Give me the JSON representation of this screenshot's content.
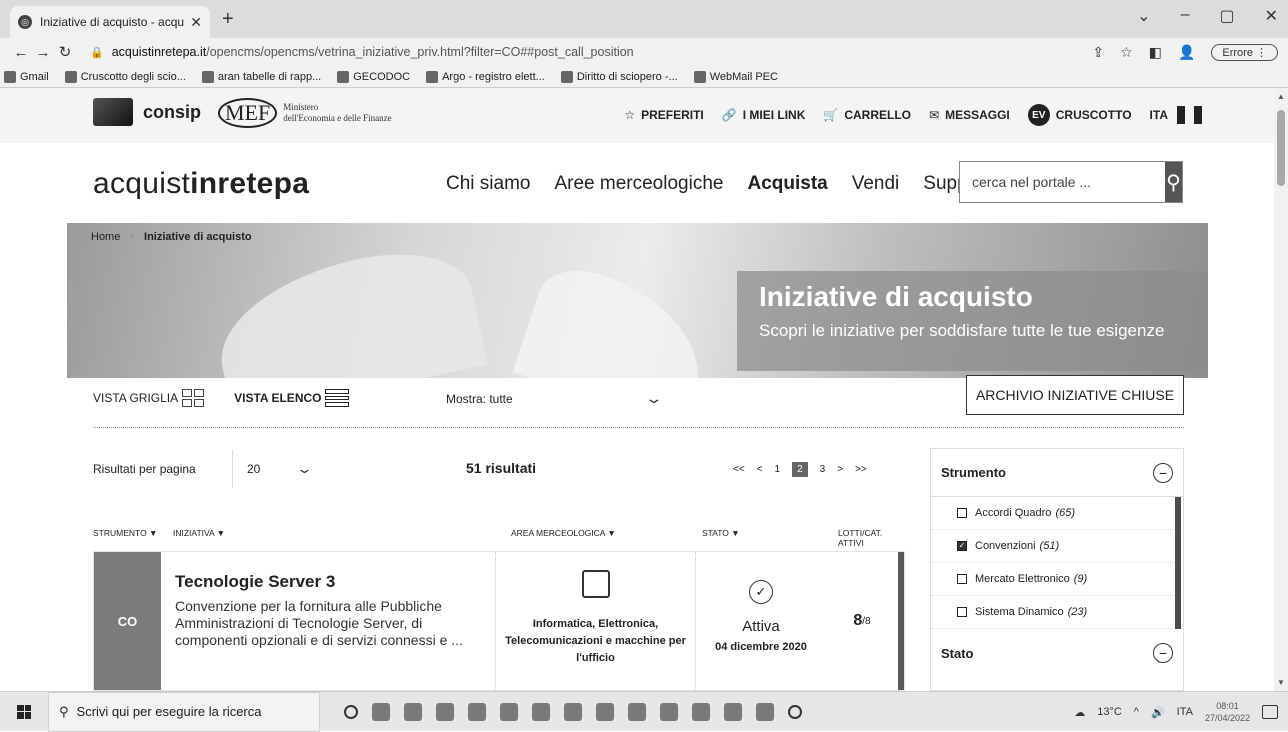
{
  "browser": {
    "tab_title": "Iniziative di acquisto - acquistinr",
    "url_host": "acquistinretepa.it",
    "url_path": "/opencms/opencms/vetrina_iniziative_priv.html?filter=CO##post_call_position",
    "error_label": "Errore",
    "bookmarks": [
      "Gmail",
      "Cruscotto degli scio...",
      "aran tabelle di rapp...",
      "GECODOC",
      "Argo - registro elett...",
      "Diritto di sciopero -...",
      "WebMail PEC"
    ]
  },
  "util": {
    "consip": "consip",
    "mef": "MEF",
    "mef_sub1": "Ministero",
    "mef_sub2": "dell'Economia e delle Finanze",
    "preferiti": "PREFERITI",
    "link": "I MIEI LINK",
    "carrello": "CARRELLO",
    "messaggi": "MESSAGGI",
    "avatar": "EV",
    "cruscotto": "CRUSCOTTO",
    "lang": "ITA"
  },
  "header": {
    "brand_light": "acquist",
    "brand_bold": "inretepa",
    "nav": [
      "Chi siamo",
      "Aree merceologiche",
      "Acquista",
      "Vendi",
      "Supporto"
    ],
    "search_placeholder": "cerca nel portale ..."
  },
  "hero": {
    "crumb_home": "Home",
    "crumb_current": "Iniziative di acquisto",
    "title": "Iniziative di acquisto",
    "subtitle": "Scopri le iniziative per soddisfare tutte le tue esigenze"
  },
  "controls": {
    "vista_griglia": "VISTA GRIGLIA",
    "vista_elenco": "VISTA ELENCO",
    "mostra": "Mostra: tutte",
    "archivio": "ARCHIVIO INIZIATIVE CHIUSE"
  },
  "results": {
    "per_page_label": "Risultati per pagina",
    "per_page_value": "20",
    "count": "51 risultati",
    "pager": [
      "<<",
      "<",
      "1",
      "2",
      "3",
      ">",
      ">>"
    ],
    "current_page": "2"
  },
  "table": {
    "headers": [
      "STRUMENTO ▼",
      "INIZIATIVA ▼",
      "AREA MERCEOLOGICA ▼",
      "STATO ▼",
      "LOTTI/CAT. ATTIVI"
    ]
  },
  "card": {
    "code": "CO",
    "title": "Tecnologie Server 3",
    "description": "Convenzione per la fornitura alle Pubbliche Amministrazioni di Tecnologie Server, di componenti opzionali e di servizi connessi e ...",
    "area": "Informatica, Elettronica, Telecomunicazioni e macchine per l'ufficio",
    "stato": "Attiva",
    "date": "04 dicembre 2020",
    "lotti_num": "8",
    "lotti_den": "/8"
  },
  "filter": {
    "strumento_title": "Strumento",
    "options": [
      {
        "label": "Accordi Quadro",
        "count": "(65)",
        "checked": false
      },
      {
        "label": "Convenzioni",
        "count": "(51)",
        "checked": true
      },
      {
        "label": "Mercato Elettronico",
        "count": "(9)",
        "checked": false
      },
      {
        "label": "Sistema Dinamico",
        "count": "(23)",
        "checked": false
      }
    ],
    "stato_title": "Stato"
  },
  "taskbar": {
    "search": "Scrivi qui per eseguire la ricerca",
    "weather": "13°C",
    "lang": "ITA",
    "time": "08:01",
    "date": "27/04/2022"
  }
}
